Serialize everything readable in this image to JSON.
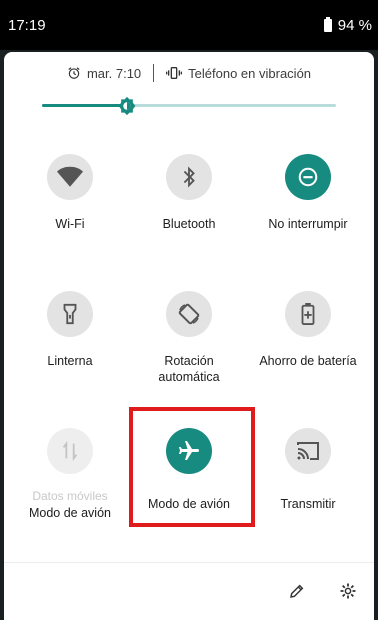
{
  "status_bar": {
    "time": "17:19",
    "battery": "94 %"
  },
  "info": {
    "alarm": "mar. 7:10",
    "ringer": "Teléfono en vibración"
  },
  "brightness": {
    "level": 0.29
  },
  "colors": {
    "accent": "#188b81",
    "highlight": "#e01b1b"
  },
  "tiles": [
    {
      "label": "Wi-Fi",
      "icon": "wifi-icon",
      "on": false
    },
    {
      "label": "Bluetooth",
      "icon": "bluetooth-icon",
      "on": false
    },
    {
      "label": "No interrumpir",
      "icon": "dnd-icon",
      "on": true
    },
    {
      "label": "Linterna",
      "icon": "flashlight-icon",
      "on": false
    },
    {
      "label_line1": "Rotación",
      "label_line2": "automática",
      "icon": "rotate-icon",
      "on": false
    },
    {
      "label": "Ahorro de batería",
      "icon": "battery-saver-icon",
      "on": false
    },
    {
      "sublabel": "Datos móviles",
      "label": "Modo de avión",
      "icon": "mobile-data-icon",
      "on": false,
      "disabled": true
    },
    {
      "label": "Modo de avión",
      "icon": "airplane-icon",
      "on": true
    },
    {
      "label": "Transmitir",
      "icon": "cast-icon",
      "on": false
    }
  ],
  "footer": {
    "edit_icon": "pencil-icon",
    "settings_icon": "gear-icon"
  }
}
